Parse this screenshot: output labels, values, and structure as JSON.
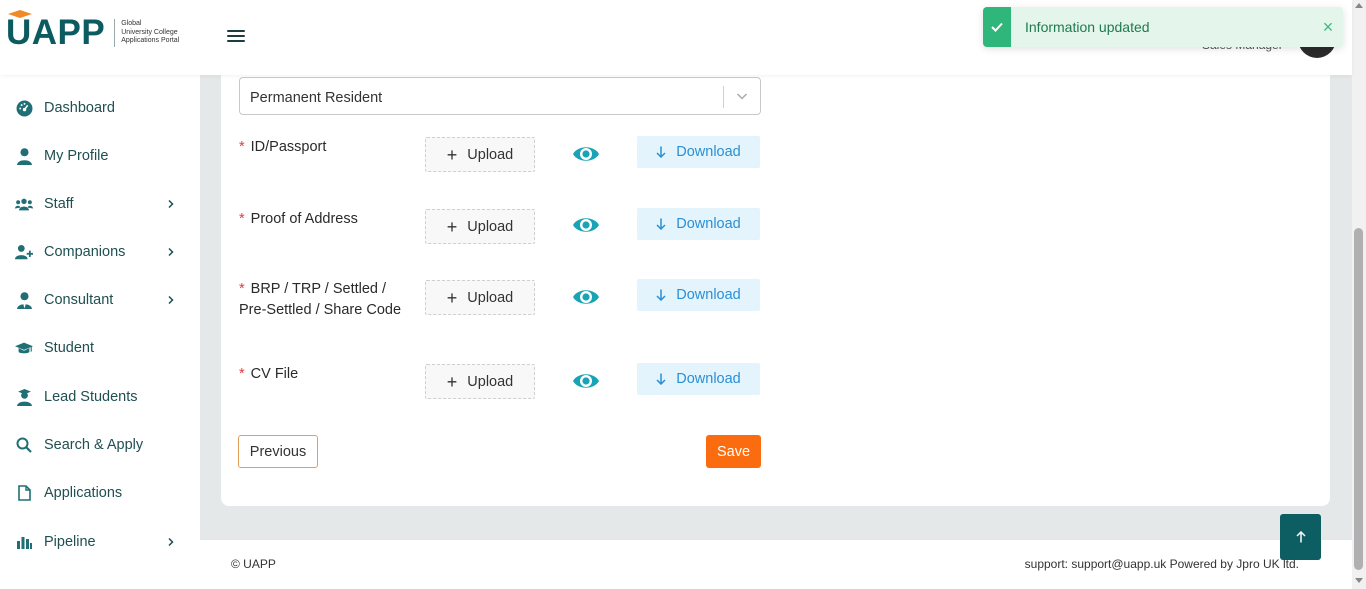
{
  "header": {
    "logo_text": "UAPP",
    "logo_tagline_1": "Global",
    "logo_tagline_2": "University College",
    "logo_tagline_3": "Applications Portal",
    "user_role": "Sales Manager"
  },
  "toast": {
    "message": "Information updated",
    "close_symbol": "×",
    "accent_color": "#2fb67a"
  },
  "sidebar": {
    "items": [
      {
        "label": "Dashboard",
        "icon": "dashboard-icon",
        "has_submenu": false
      },
      {
        "label": "My Profile",
        "icon": "user-icon",
        "has_submenu": false
      },
      {
        "label": "Staff",
        "icon": "users-icon",
        "has_submenu": true
      },
      {
        "label": "Companions",
        "icon": "user-plus-icon",
        "has_submenu": true
      },
      {
        "label": "Consultant",
        "icon": "user-tie-icon",
        "has_submenu": true
      },
      {
        "label": "Student",
        "icon": "graduation-cap-icon",
        "has_submenu": false
      },
      {
        "label": "Lead Students",
        "icon": "user-graduate-icon",
        "has_submenu": false
      },
      {
        "label": "Search & Apply",
        "icon": "search-icon",
        "has_submenu": false
      },
      {
        "label": "Applications",
        "icon": "file-icon",
        "has_submenu": false
      },
      {
        "label": "Pipeline",
        "icon": "bar-chart-icon",
        "has_submenu": true
      }
    ]
  },
  "form": {
    "residency_select_value": "Permanent Resident",
    "documents": [
      {
        "label_line1": "ID/Passport",
        "label_rest": ""
      },
      {
        "label_line1": "Proof of Address",
        "label_rest": ""
      },
      {
        "label_line1": "BRP / TRP / Settled /",
        "label_rest": "Pre-Settled / Share Code"
      },
      {
        "label_line1": "CV File",
        "label_rest": ""
      }
    ],
    "required_marker": "*",
    "upload_label": "Upload",
    "download_label": "Download",
    "previous_label": "Previous",
    "save_label": "Save"
  },
  "footer": {
    "copyright": "© UAPP",
    "support": "support: support@uapp.uk  Powered by Jpro UK ltd."
  },
  "colors": {
    "brand_teal": "#0c5b60",
    "save_orange": "#fb6c10",
    "download_blue": "#2a8fd6",
    "eye_teal": "#1aa3b5"
  }
}
